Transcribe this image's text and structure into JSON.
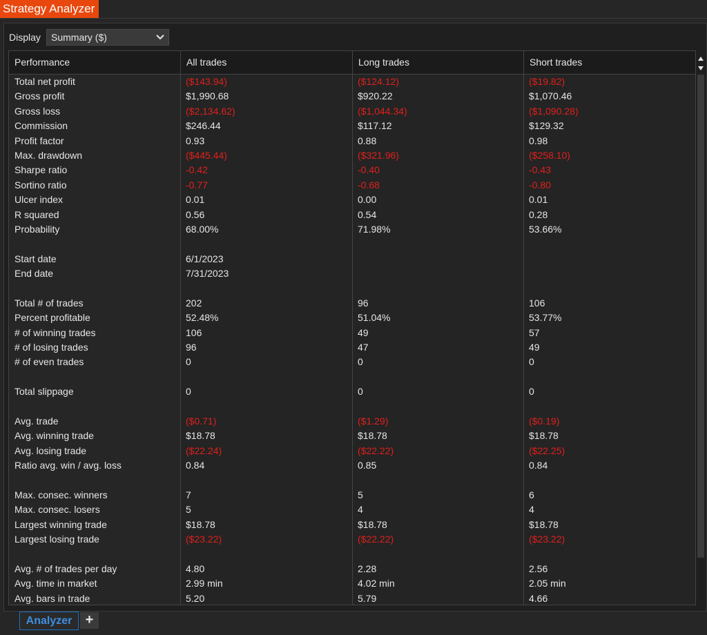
{
  "window": {
    "title": "Strategy Analyzer"
  },
  "display": {
    "label": "Display",
    "selected": "Summary ($)"
  },
  "table": {
    "headers": [
      "Performance",
      "All trades",
      "Long trades",
      "Short trades"
    ],
    "rows": [
      {
        "label": "Total net profit",
        "all": "($143.94)",
        "long": "($124.12)",
        "short": "($19.82)",
        "negative": true
      },
      {
        "label": "Gross profit",
        "all": "$1,990.68",
        "long": "$920.22",
        "short": "$1,070.46",
        "negative": false
      },
      {
        "label": "Gross loss",
        "all": "($2,134.62)",
        "long": "($1,044.34)",
        "short": "($1,090.28)",
        "negative": true
      },
      {
        "label": "Commission",
        "all": "$246.44",
        "long": "$117.12",
        "short": "$129.32",
        "negative": false
      },
      {
        "label": "Profit factor",
        "all": "0.93",
        "long": "0.88",
        "short": "0.98",
        "negative": false
      },
      {
        "label": "Max. drawdown",
        "all": "($445.44)",
        "long": "($321.96)",
        "short": "($258.10)",
        "negative": true
      },
      {
        "label": "Sharpe ratio",
        "all": "-0.42",
        "long": "-0.40",
        "short": "-0.43",
        "negative": true
      },
      {
        "label": "Sortino ratio",
        "all": "-0.77",
        "long": "-0.68",
        "short": "-0.80",
        "negative": true
      },
      {
        "label": "Ulcer index",
        "all": "0.01",
        "long": "0.00",
        "short": "0.01",
        "negative": false
      },
      {
        "label": "R squared",
        "all": "0.56",
        "long": "0.54",
        "short": "0.28",
        "negative": false
      },
      {
        "label": "Probability",
        "all": "68.00%",
        "long": "71.98%",
        "short": "53.66%",
        "negative": false
      },
      {
        "label": "",
        "all": "",
        "long": "",
        "short": "",
        "negative": false
      },
      {
        "label": "Start date",
        "all": "6/1/2023",
        "long": "",
        "short": "",
        "negative": false
      },
      {
        "label": "End date",
        "all": "7/31/2023",
        "long": "",
        "short": "",
        "negative": false
      },
      {
        "label": "",
        "all": "",
        "long": "",
        "short": "",
        "negative": false
      },
      {
        "label": "Total # of trades",
        "all": "202",
        "long": "96",
        "short": "106",
        "negative": false
      },
      {
        "label": "Percent profitable",
        "all": "52.48%",
        "long": "51.04%",
        "short": "53.77%",
        "negative": false
      },
      {
        "label": "# of winning trades",
        "all": "106",
        "long": "49",
        "short": "57",
        "negative": false
      },
      {
        "label": "# of losing trades",
        "all": "96",
        "long": "47",
        "short": "49",
        "negative": false
      },
      {
        "label": "# of even trades",
        "all": "0",
        "long": "0",
        "short": "0",
        "negative": false
      },
      {
        "label": "",
        "all": "",
        "long": "",
        "short": "",
        "negative": false
      },
      {
        "label": "Total slippage",
        "all": "0",
        "long": "0",
        "short": "0",
        "negative": false
      },
      {
        "label": "",
        "all": "",
        "long": "",
        "short": "",
        "negative": false
      },
      {
        "label": "Avg. trade",
        "all": "($0.71)",
        "long": "($1.29)",
        "short": "($0.19)",
        "negative": true
      },
      {
        "label": "Avg. winning trade",
        "all": "$18.78",
        "long": "$18.78",
        "short": "$18.78",
        "negative": false
      },
      {
        "label": "Avg. losing trade",
        "all": "($22.24)",
        "long": "($22.22)",
        "short": "($22.25)",
        "negative": true
      },
      {
        "label": "Ratio avg. win / avg. loss",
        "all": "0.84",
        "long": "0.85",
        "short": "0.84",
        "negative": false
      },
      {
        "label": "",
        "all": "",
        "long": "",
        "short": "",
        "negative": false
      },
      {
        "label": "Max. consec. winners",
        "all": "7",
        "long": "5",
        "short": "6",
        "negative": false
      },
      {
        "label": "Max. consec. losers",
        "all": "5",
        "long": "4",
        "short": "4",
        "negative": false
      },
      {
        "label": "Largest winning trade",
        "all": "$18.78",
        "long": "$18.78",
        "short": "$18.78",
        "negative": false
      },
      {
        "label": "Largest losing trade",
        "all": "($23.22)",
        "long": "($22.22)",
        "short": "($23.22)",
        "negative": true
      },
      {
        "label": "",
        "all": "",
        "long": "",
        "short": "",
        "negative": false
      },
      {
        "label": "Avg. # of trades per day",
        "all": "4.80",
        "long": "2.28",
        "short": "2.56",
        "negative": false
      },
      {
        "label": "Avg. time in market",
        "all": "2.99 min",
        "long": "4.02 min",
        "short": "2.05 min",
        "negative": false
      },
      {
        "label": "Avg. bars in trade",
        "all": "5.20",
        "long": "5.79",
        "short": "4.66",
        "negative": false
      }
    ]
  },
  "tabs": {
    "active": "Analyzer",
    "add": "+"
  },
  "colors": {
    "accent": "#e8480e",
    "negative": "#e0201c",
    "tab_active": "#3d8fe0"
  }
}
